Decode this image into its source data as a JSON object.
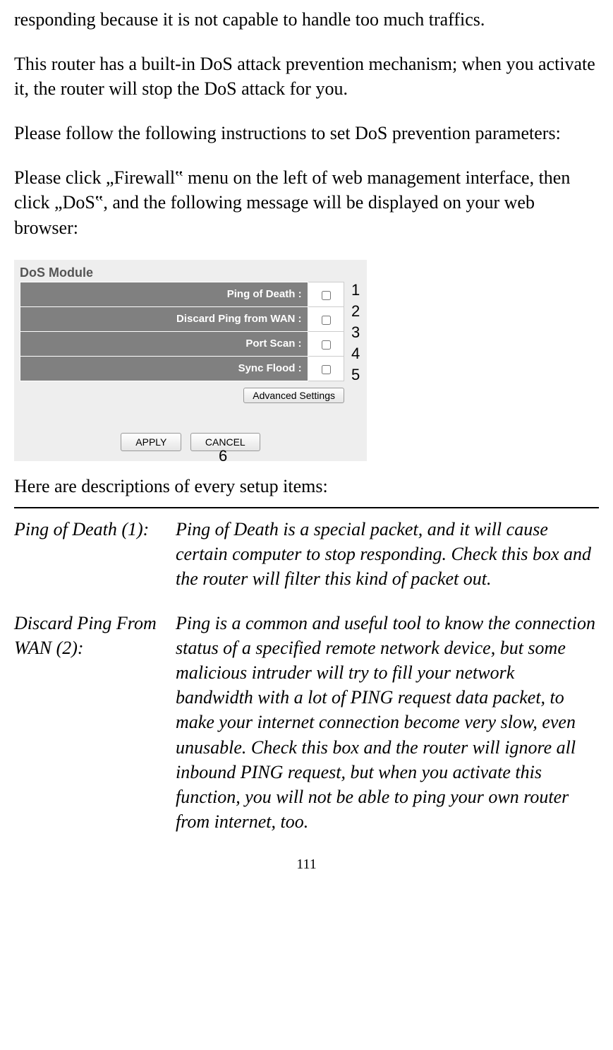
{
  "paragraphs": {
    "p1": "responding because it is not capable to handle too much traffics.",
    "p2": "This router has a built-in DoS attack prevention mechanism; when you activate it, the router will stop the DoS attack for you.",
    "p3": "Please follow the following instructions to set DoS prevention parameters:",
    "p4": "Please click „Firewall‟ menu on the left of web management interface, then click „DoS‟, and the following message will be displayed on your web browser:"
  },
  "screenshot": {
    "module_title": "DoS Module",
    "rows": [
      {
        "label": "Ping of Death :",
        "annot": "1"
      },
      {
        "label": "Discard Ping from WAN :",
        "annot": "2"
      },
      {
        "label": "Port Scan :",
        "annot": "3"
      },
      {
        "label": "Sync Flood :",
        "annot": "4"
      }
    ],
    "advanced_button": "Advanced Settings",
    "advanced_annot": "5",
    "apply_button": "APPLY",
    "cancel_button": "CANCEL",
    "bottom_annot": "6"
  },
  "desc_intro": "Here are descriptions of every setup items:",
  "descriptions": [
    {
      "term": "Ping of Death (1):",
      "text": "Ping of Death is a special packet, and it will cause certain computer to stop responding. Check this box and the router will filter this kind of packet out."
    },
    {
      "term": "Discard Ping From WAN (2):",
      "text": "Ping is a common and useful tool to know the connection status of a specified remote network device, but some malicious intruder will try to fill your network bandwidth with a lot of PING request data packet, to make your internet connection become very slow, even unusable. Check this box and the router will ignore all inbound PING request, but when you activate this function, you will not be able to ping your own router from internet, too."
    }
  ],
  "page_number": "111"
}
